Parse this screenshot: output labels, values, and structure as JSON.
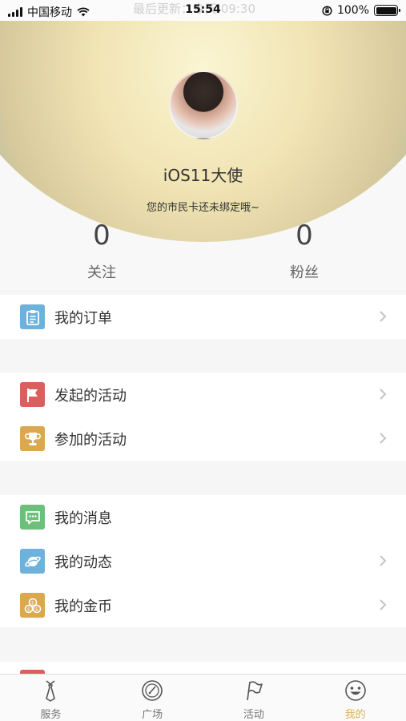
{
  "status_bar": {
    "carrier": "中国移动",
    "time": "15:54",
    "ghost_text": "最后更新：今天 09:30",
    "battery": "100%"
  },
  "profile": {
    "username": "iOS11大使",
    "bind_hint": "您的市民卡还未绑定哦~",
    "follow_count": "0",
    "follow_label": "关注",
    "fans_count": "0",
    "fans_label": "粉丝"
  },
  "menu": {
    "orders": {
      "label": "我的订单",
      "icon": "clipboard-icon",
      "color": "#6eb2dc"
    },
    "launched": {
      "label": "发起的活动",
      "icon": "flag-icon",
      "color": "#d9605c"
    },
    "joined": {
      "label": "参加的活动",
      "icon": "trophy-icon",
      "color": "#d9a84f"
    },
    "messages": {
      "label": "我的消息",
      "icon": "message-icon",
      "color": "#6cc07a"
    },
    "feed": {
      "label": "我的动态",
      "icon": "planet-icon",
      "color": "#6eb2dc"
    },
    "coins": {
      "label": "我的金币",
      "icon": "coins-icon",
      "color": "#d9a84f"
    }
  },
  "tabs": [
    {
      "label": "服务",
      "icon": "tie-icon"
    },
    {
      "label": "广场",
      "icon": "compass-icon"
    },
    {
      "label": "活动",
      "icon": "flag-outline-icon"
    },
    {
      "label": "我的",
      "icon": "smiley-icon",
      "active": true,
      "active_color": "#e0b056"
    }
  ]
}
